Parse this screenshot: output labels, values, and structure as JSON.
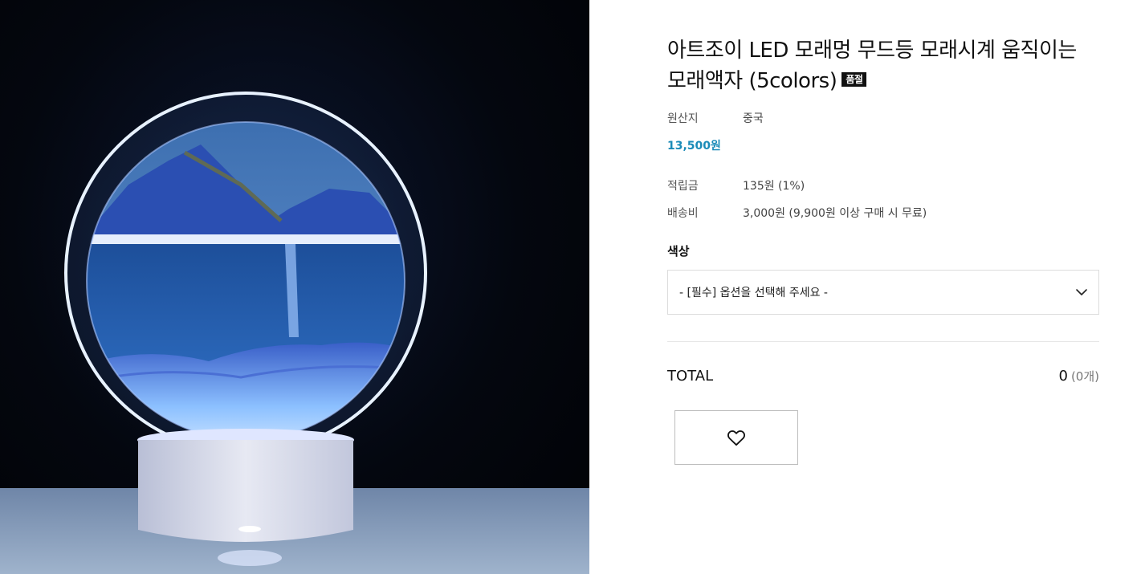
{
  "product": {
    "title": "아트조이 LED 모래멍 무드등 모래시계 움직이는 모래액자 (5colors)",
    "soldout_badge": "품절",
    "origin_label": "원산지",
    "origin_value": "중국",
    "price": "13,500원",
    "points_label": "적립금",
    "points_value": "135원 (1%)",
    "shipping_label": "배송비",
    "shipping_value": "3,000원 (9,900원 이상 구매 시 무료)"
  },
  "option": {
    "label": "색상",
    "placeholder": "- [필수] 옵션을 선택해 주세요 -"
  },
  "total": {
    "label": "TOTAL",
    "amount": "0",
    "count": "(0개)"
  },
  "icons": {
    "select": "chevron-down-icon",
    "wish": "heart-icon"
  },
  "colors": {
    "price": "#1a8bb8",
    "badge_bg": "#111111"
  }
}
